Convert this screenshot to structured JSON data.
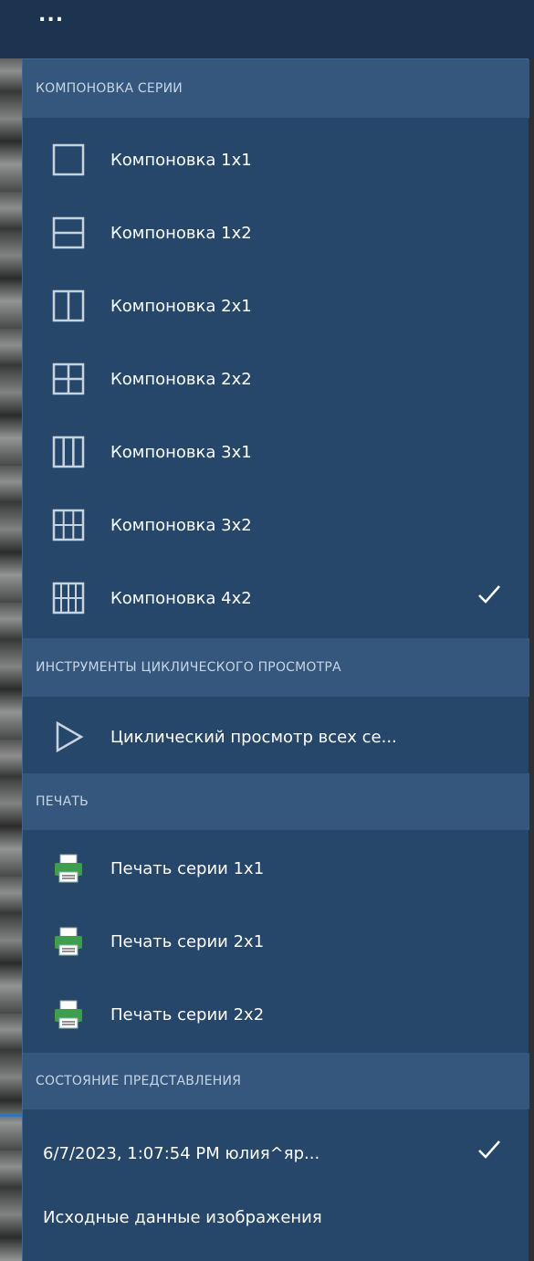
{
  "topbar": {
    "more_label": "..."
  },
  "sections": {
    "layout": {
      "header": "КОМПОНОВКА СЕРИИ",
      "items": [
        {
          "label": "Компоновка 1x1",
          "icon": "layout-1x1-icon",
          "checked": false
        },
        {
          "label": "Компоновка 1x2",
          "icon": "layout-1x2-icon",
          "checked": false
        },
        {
          "label": "Компоновка 2x1",
          "icon": "layout-2x1-icon",
          "checked": false
        },
        {
          "label": "Компоновка 2x2",
          "icon": "layout-2x2-icon",
          "checked": false
        },
        {
          "label": "Компоновка 3x1",
          "icon": "layout-3x1-icon",
          "checked": false
        },
        {
          "label": "Компоновка 3x2",
          "icon": "layout-3x2-icon",
          "checked": false
        },
        {
          "label": "Компоновка 4x2",
          "icon": "layout-4x2-icon",
          "checked": true
        }
      ]
    },
    "cine": {
      "header": "ИНСТРУМЕНТЫ ЦИКЛИЧЕСКОГО ПРОСМОТРА",
      "items": [
        {
          "label": "Циклический просмотр всех се...",
          "icon": "play-icon"
        }
      ]
    },
    "print": {
      "header": "ПЕЧАТЬ",
      "items": [
        {
          "label": "Печать серии 1x1",
          "icon": "printer-icon"
        },
        {
          "label": "Печать серии 2x1",
          "icon": "printer-icon"
        },
        {
          "label": "Печать серии 2x2",
          "icon": "printer-icon"
        }
      ]
    },
    "state": {
      "header": "СОСТОЯНИЕ ПРЕДСТАВЛЕНИЯ",
      "items": [
        {
          "label": "6/7/2023, 1:07:54 PM юлия^яр...",
          "checked": true
        },
        {
          "label": "Исходные данные изображения",
          "checked": false
        }
      ]
    }
  },
  "colors": {
    "menu_bg": "#26466a",
    "section_bg": "#35567d",
    "topbar_bg": "#1c3450",
    "icon_stroke": "#c9d3dd",
    "printer_green": "#3f9e4d"
  }
}
